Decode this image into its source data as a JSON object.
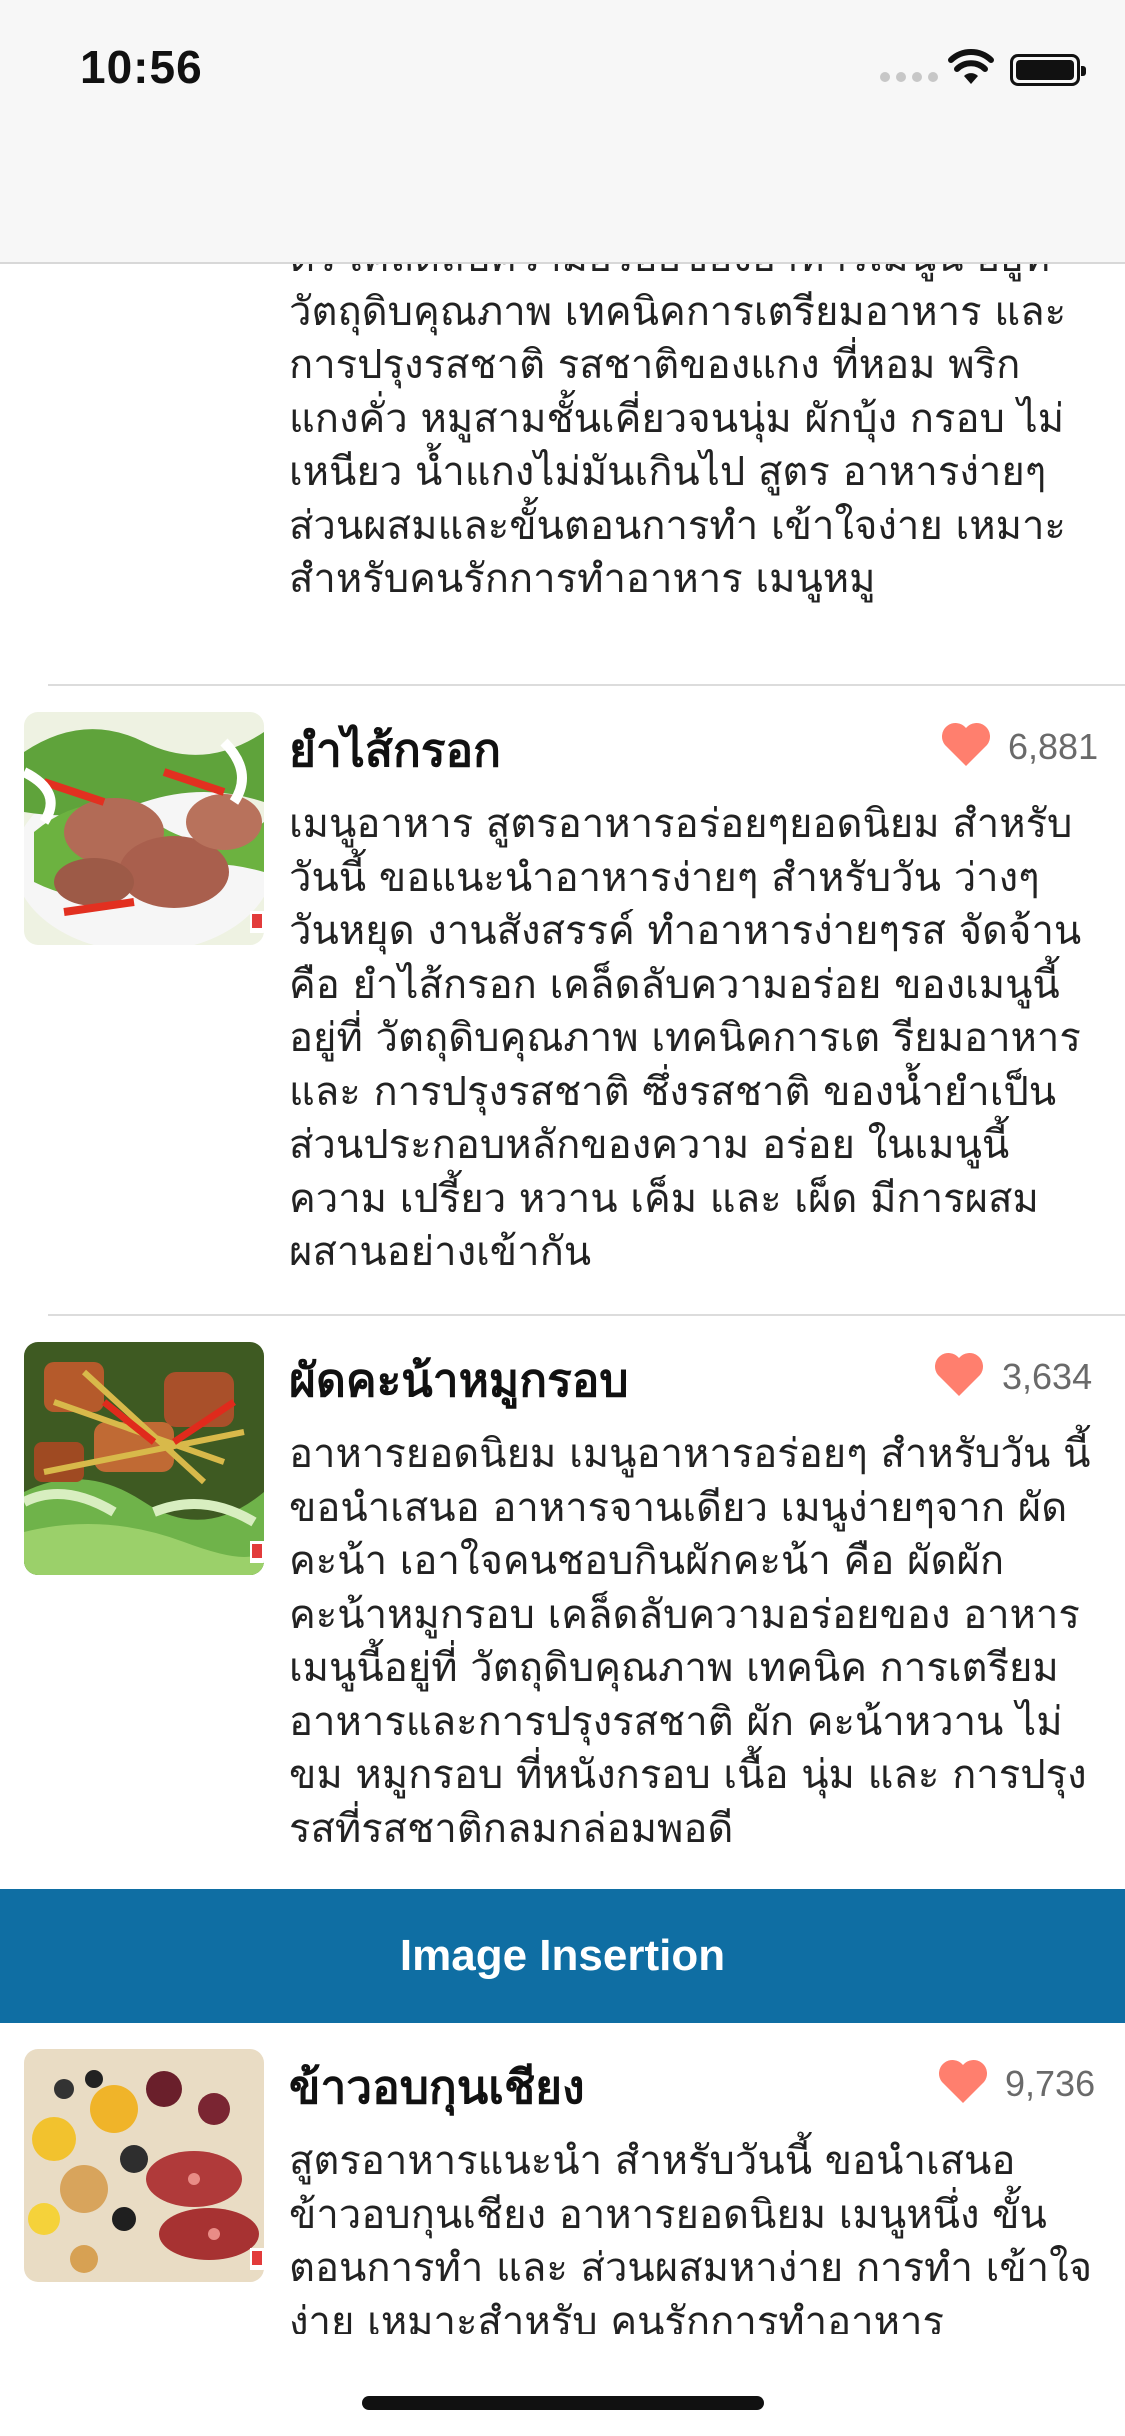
{
  "status_bar": {
    "time": "10:56"
  },
  "previous_item": {
    "description": "ตร เคล็ดลับความอร่อยของอาหารเมนูนี้ อยู่ที่ วัตถุดิบคุณภาพ เทคนิคการเตรียมอาหาร และ การปรุงรสชาติ รสชาติของแกง ที่หอม พริกแกงคั่ว หมูสามชั้นเคี่ยวจนนุ่ม ผักบุ้ง กรอบ ไม่เหนียว น้ำแกงไม่มันเกินไป สูตร อาหารง่ายๆ ส่วนผสมและขั้นตอนการทำ เข้าใจง่าย เหมาะสำหรับคนรักการทำอาหาร เมนูหมู"
  },
  "recipes": [
    {
      "title": "ยำไส้กรอก",
      "likes": "6,881",
      "description": "เมนูอาหาร สูตรอาหารอร่อยๆยอดนิยม สำหรับวันนี้ ขอแนะนำอาหารง่ายๆ สำหรับวัน ว่างๆ วันหยุด งานสังสรรค์ ทำอาหารง่ายๆรส จัดจ้าน คือ ยำไส้กรอก เคล็ดลับความอร่อย ของเมนูนี้อยู่ที่ วัตถุดิบคุณภาพ เทคนิคการเต รียมอาหาร และ การปรุงรสชาติ ซึ่งรสชาติ ของน้ำยำเป็นส่วนประกอบหลักของความ อร่อย ในเมนูนี้ ความ เปรี้ยว หวาน เค็ม และ เผ็ด มีการผสมผสานอย่างเข้ากัน"
    },
    {
      "title": "ผัดคะน้าหมูกรอบ",
      "likes": "3,634",
      "description": "อาหารยอดนิยม เมนูอาหารอร่อยๆ สำหรับวัน นี้ ขอนำเสนอ อาหารจานเดียว เมนูง่ายๆจาก ผัดคะน้า เอาใจคนชอบกินผักคะน้า คือ ผัดผัก คะน้าหมูกรอบ เคล็ดลับความอร่อยของ อาหารเมนูนี้อยู่ที่ วัตถุดิบคุณภาพ เทคนิค การเตรียมอาหารและการปรุงรสชาติ  ผัก คะน้าหวาน ไม่ขม หมูกรอบ ที่หนังกรอบ เนื้อ นุ่ม และ การปรุงรสที่รสชาติกลมกล่อมพอดี"
    },
    {
      "title": "ข้าวอบกุนเชียง",
      "likes": "9,736",
      "description": "สูตรอาหารแนะนำ สำหรับวันนี้ ขอนำเสนอ ข้าวอบกุนเชียง อาหารยอดนิยม เมนูหนึ่ง ขั้น ตอนการทำ และ ส่วนผสมหาง่าย การทำ เข้าใจง่าย เหมาะสำหรับ คนรักการทำอาหาร"
    }
  ],
  "banner": {
    "label": "Image Insertion"
  },
  "colors": {
    "banner_bg": "#0f6ea3",
    "heart": "#ff7f6e",
    "likes_text": "#6a6a6a"
  },
  "icons": {
    "heart": "heart-icon",
    "wifi": "wifi-icon",
    "battery": "battery-icon"
  }
}
